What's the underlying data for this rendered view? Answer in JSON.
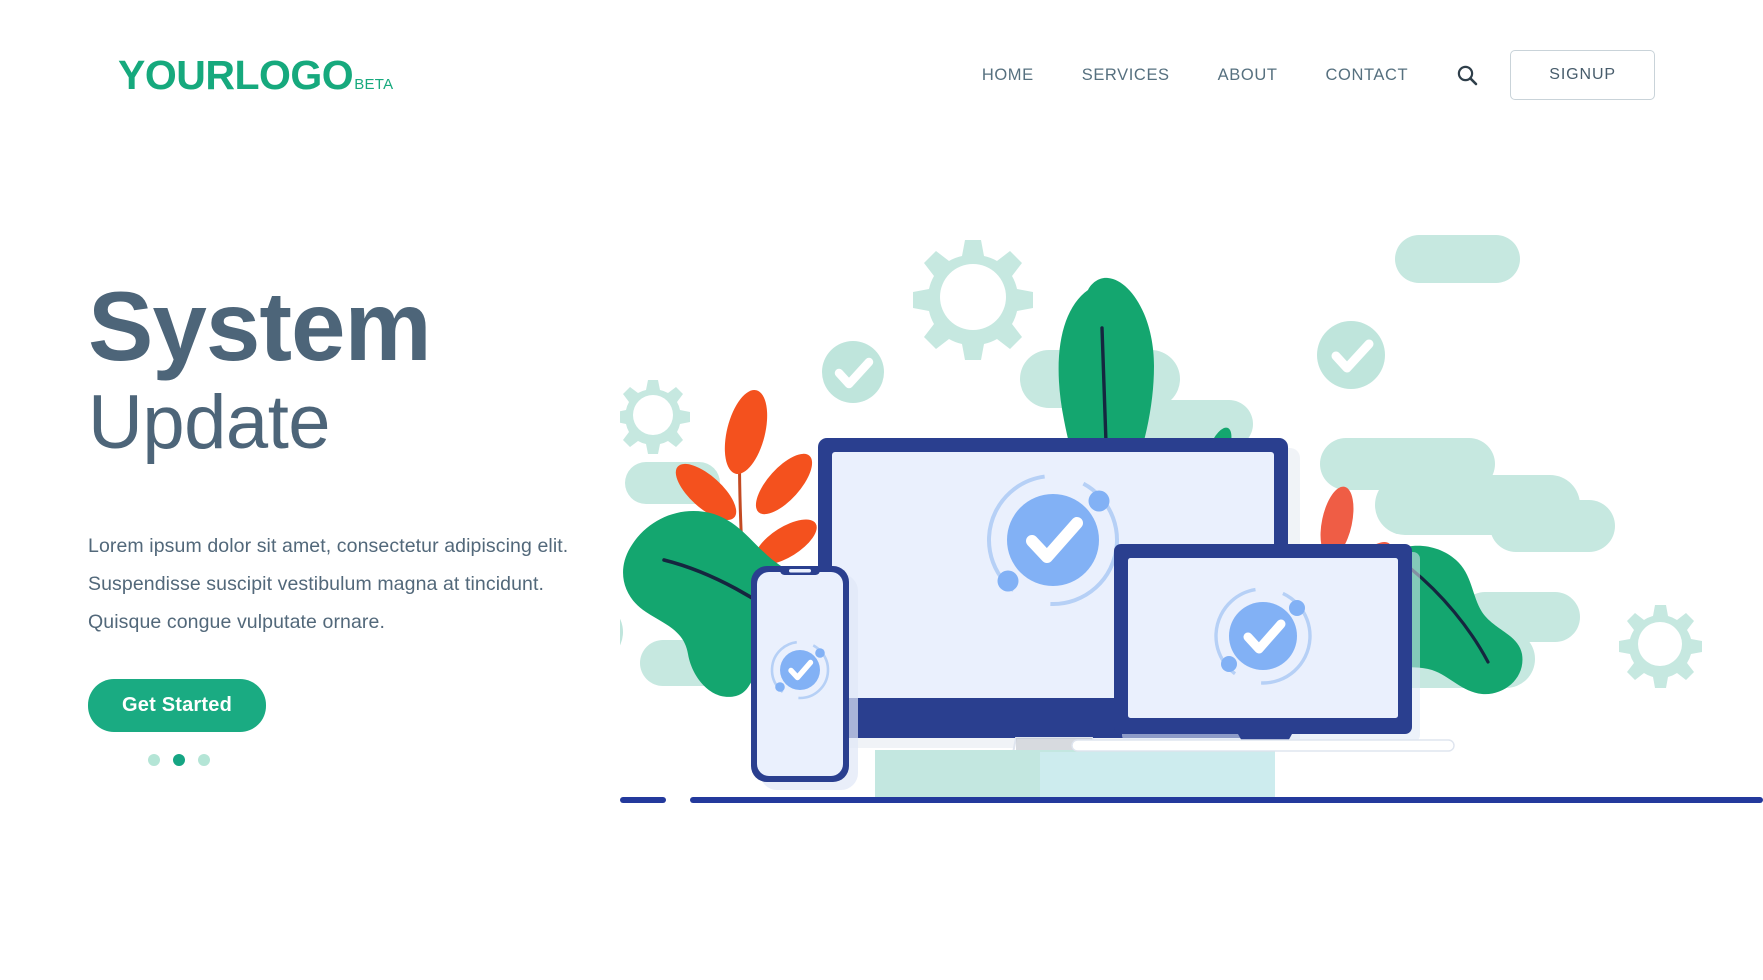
{
  "header": {
    "logo": {
      "main": "YOURLOGO",
      "beta": "BETA"
    },
    "nav": [
      {
        "label": "HOME",
        "name": "nav-item-home"
      },
      {
        "label": "SERVICES",
        "name": "nav-item-services"
      },
      {
        "label": "ABOUT",
        "name": "nav-item-about"
      },
      {
        "label": "CONTACT",
        "name": "nav-item-contact"
      }
    ],
    "search_icon": "search-icon",
    "signup_label": "SIGNUP"
  },
  "hero": {
    "title_line1": "System",
    "title_line2": "Update",
    "paragraph": [
      "Lorem ipsum dolor sit amet, consectetur adipiscing elit.",
      "Suspendisse suscipit vestibulum magna at tincidunt.",
      "Quisque congue vulputate ornare."
    ],
    "cta_label": "Get Started",
    "carousel": {
      "count": 3,
      "active_index": 1
    }
  },
  "illustration": {
    "name": "system-update-devices-illustration",
    "devices": [
      "desktop-monitor",
      "smartphone",
      "laptop"
    ],
    "motif": [
      "gear",
      "checkmark-circle",
      "leaf-branch",
      "foliage-blob",
      "pill-shape"
    ]
  },
  "colors": {
    "brand_green": "#16a97d",
    "cta_green": "#1aab82",
    "heading_slate": "#4d6579",
    "nav_slate": "#56707f",
    "device_navy": "#2a3f8f",
    "screen_lavender": "#eaf0fd",
    "check_blue": "#82b1f5",
    "mint": "#bfe7dd",
    "leaf_orange": "#f4511e",
    "leaf_coral": "#ef5d45",
    "foliage_green": "#14a66f"
  }
}
